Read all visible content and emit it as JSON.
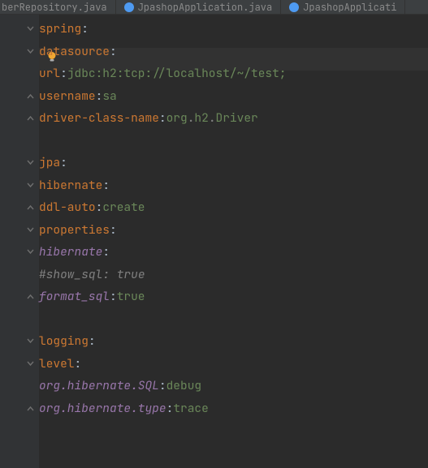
{
  "tabs": [
    {
      "label": "berRepository.java",
      "icon_color": ""
    },
    {
      "label": "JpashopApplication.java",
      "icon_color": "#4e9af1"
    },
    {
      "label": "JpashopApplicati",
      "icon_color": "#4e9af1"
    }
  ],
  "colon": ":",
  "hash": "#",
  "dot": ".",
  "code": {
    "l1_key": "spring",
    "l2_key": "datasource",
    "l3_key": "url",
    "l3_val": "jdbc:h2:tcp://localhost/~/test;",
    "l4_key": "username",
    "l4_val": "sa",
    "l5_key": "driver-class-name",
    "l5_pkg1": "org",
    "l5_pkg2": "h2",
    "l5_cls": "Driver",
    "l7_key": "jpa",
    "l8_key": "hibernate",
    "l9_key": "ddl-auto",
    "l9_val": "create",
    "l10_key": "properties",
    "l11_key": "hibernate",
    "l12_key": "show_sql",
    "l12_colon": ": ",
    "l12_val": "true",
    "l13_key": "format_sql",
    "l13_val": "true",
    "l15_key": "logging",
    "l16_key": "level",
    "l17_key": "org.hibernate.SQL",
    "l17_val": "debug",
    "l18_key": "org.hibernate.type",
    "l18_val": "trace"
  }
}
